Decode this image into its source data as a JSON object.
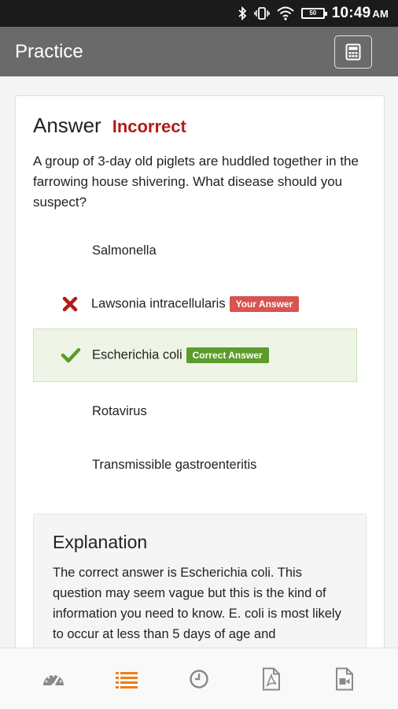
{
  "status_bar": {
    "time": "10:49",
    "ampm": "AM",
    "battery": "50",
    "icons": [
      "bluetooth-icon",
      "vibrate-icon",
      "wifi-icon",
      "battery-icon"
    ]
  },
  "app_bar": {
    "title": "Practice",
    "calculator_icon": "calculator-icon"
  },
  "result": {
    "heading": "Answer",
    "status": "Incorrect",
    "status_color": "#b31b1b"
  },
  "question": {
    "text": "A group of 3-day old piglets are huddled together in the farrowing house shivering. What disease should you suspect?"
  },
  "options": [
    {
      "text": "Salmonella"
    },
    {
      "text": "Lawsonia intracellularis",
      "tag": "Your Answer",
      "mark": "cross-icon"
    },
    {
      "text": "Escherichia coli",
      "tag": "Correct Answer",
      "mark": "check-icon"
    },
    {
      "text": "Rotavirus"
    },
    {
      "text": "Transmissible gastroenteritis"
    }
  ],
  "explanation": {
    "title": "Explanation",
    "text": "The correct answer is Escherichia coli. This question may seem vague but this is the kind of information you need to know. E. coli is most likely to occur at less than 5 days of age and"
  },
  "bottom_nav": {
    "items": [
      {
        "icon": "dashboard-icon",
        "active": false
      },
      {
        "icon": "list-icon",
        "active": true
      },
      {
        "icon": "clock-icon",
        "active": false
      },
      {
        "icon": "pdf-icon",
        "active": false
      },
      {
        "icon": "video-icon",
        "active": false
      }
    ],
    "active_color": "#f07c1a",
    "inactive_color": "#8a8a8a"
  }
}
